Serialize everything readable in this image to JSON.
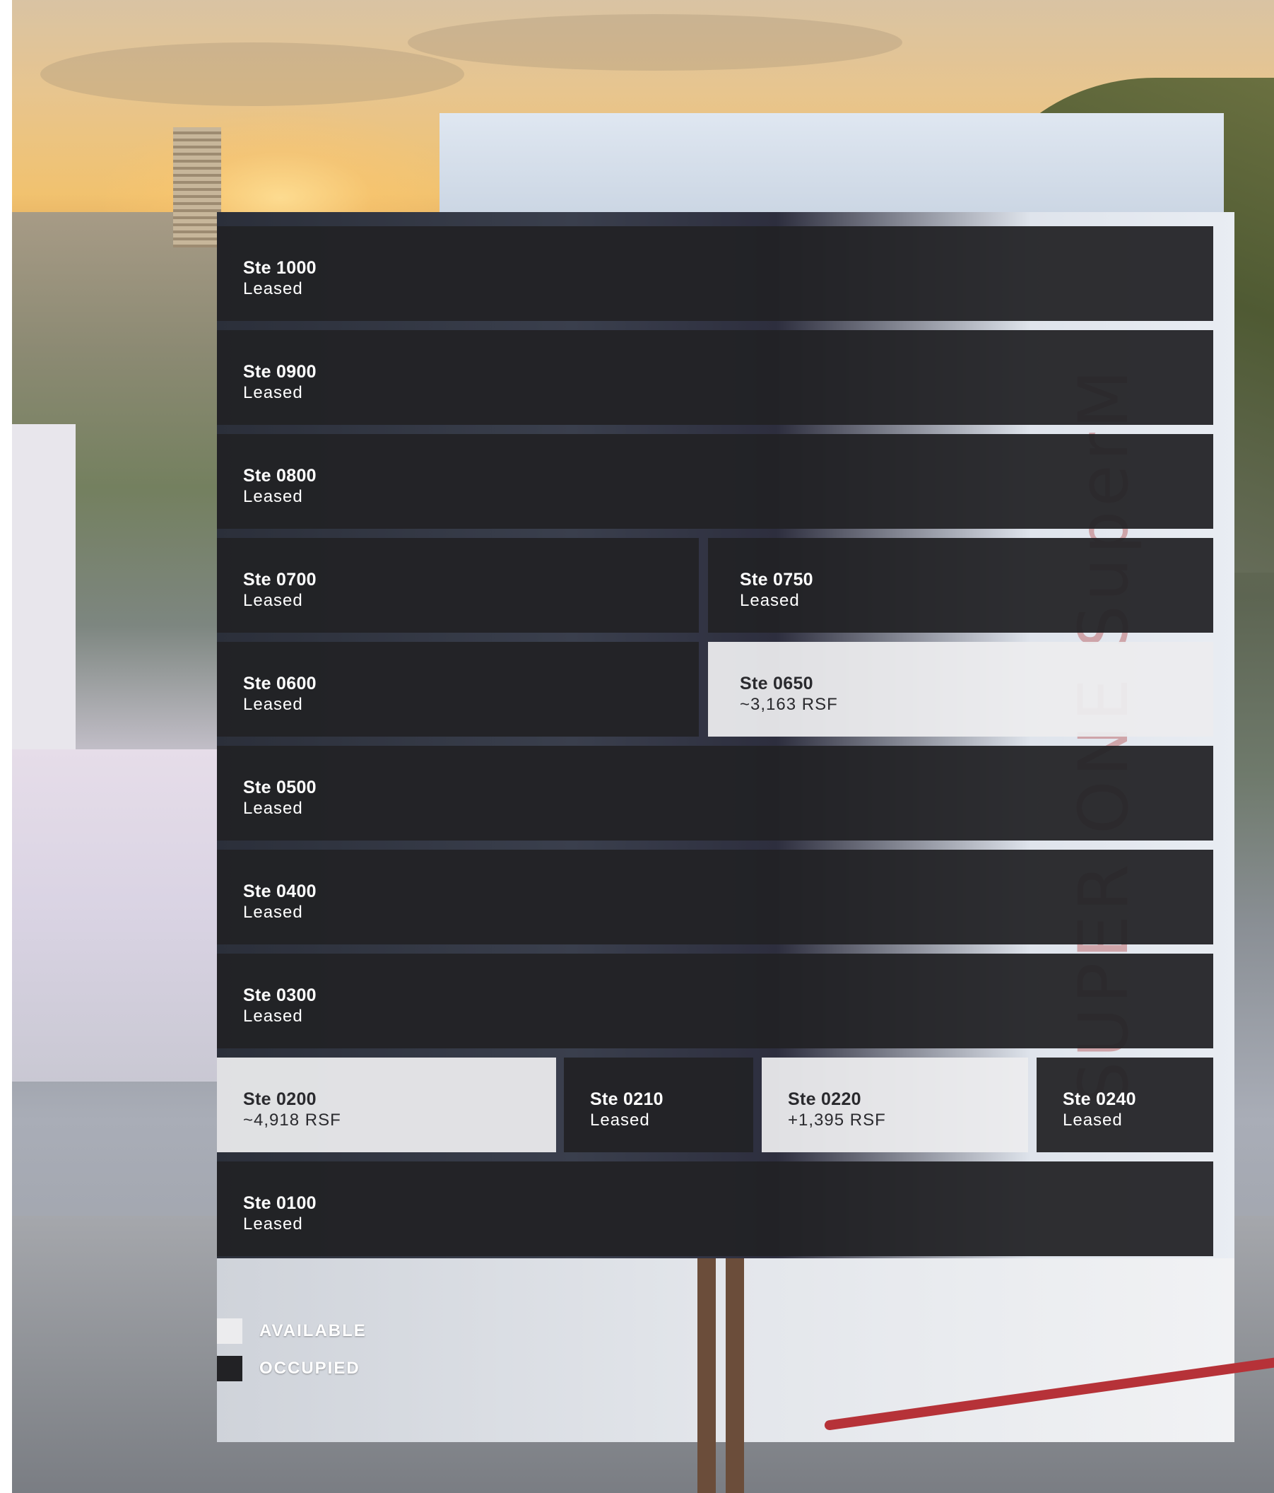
{
  "colors": {
    "available": "#ececee",
    "occupied": "#222225",
    "text_light": "#ffffff",
    "text_dark": "#2a2a2e"
  },
  "background": {
    "description_icon": "building-photo",
    "brand_on_facade": "SUPER ONE SuperM"
  },
  "suites": [
    {
      "name": "Ste 1000",
      "status": "Leased",
      "availability": "occupied"
    },
    {
      "name": "Ste 0900",
      "status": "Leased",
      "availability": "occupied"
    },
    {
      "name": "Ste 0800",
      "status": "Leased",
      "availability": "occupied"
    },
    {
      "name": "Ste 0700",
      "status": "Leased",
      "availability": "occupied"
    },
    {
      "name": "Ste 0750",
      "status": "Leased",
      "availability": "occupied"
    },
    {
      "name": "Ste 0600",
      "status": "Leased",
      "availability": "occupied"
    },
    {
      "name": "Ste 0650",
      "status": "~3,163 RSF",
      "availability": "available"
    },
    {
      "name": "Ste 0500",
      "status": "Leased",
      "availability": "occupied"
    },
    {
      "name": "Ste 0400",
      "status": "Leased",
      "availability": "occupied"
    },
    {
      "name": "Ste 0300",
      "status": "Leased",
      "availability": "occupied"
    },
    {
      "name": "Ste 0200",
      "status": "~4,918 RSF",
      "availability": "available"
    },
    {
      "name": "Ste 0210",
      "status": "Leased",
      "availability": "occupied"
    },
    {
      "name": "Ste 0220",
      "status": "+1,395 RSF",
      "availability": "available"
    },
    {
      "name": "Ste 0240",
      "status": "Leased",
      "availability": "occupied"
    },
    {
      "name": "Ste 0100",
      "status": "Leased",
      "availability": "occupied"
    }
  ],
  "legend": {
    "available_label": "AVAILABLE",
    "occupied_label": "OCCUPIED"
  }
}
